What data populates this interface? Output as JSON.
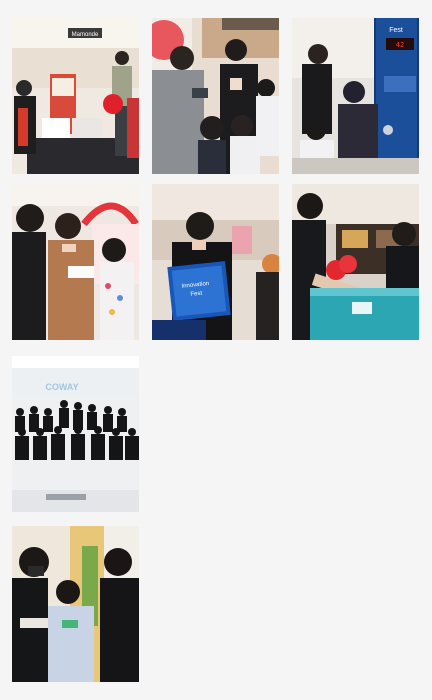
{
  "gallery": {
    "photos": [
      {
        "kind": "photo",
        "caption": ""
      },
      {
        "kind": "photo",
        "caption": ""
      },
      {
        "kind": "photo",
        "caption": ""
      },
      {
        "kind": "photo",
        "caption": ""
      },
      {
        "kind": "photo",
        "caption": ""
      },
      {
        "kind": "photo",
        "caption": ""
      },
      {
        "kind": "photo",
        "caption": ""
      },
      {
        "kind": "photo",
        "caption": ""
      }
    ],
    "signage": {
      "p1_shop_sign": "Mamonde",
      "p3_banner_title": "Fest",
      "p3_counter": "42",
      "p5_card_line1": "Innovation",
      "p5_card_line2": "Fest",
      "p7_brand": "COWAY"
    }
  }
}
